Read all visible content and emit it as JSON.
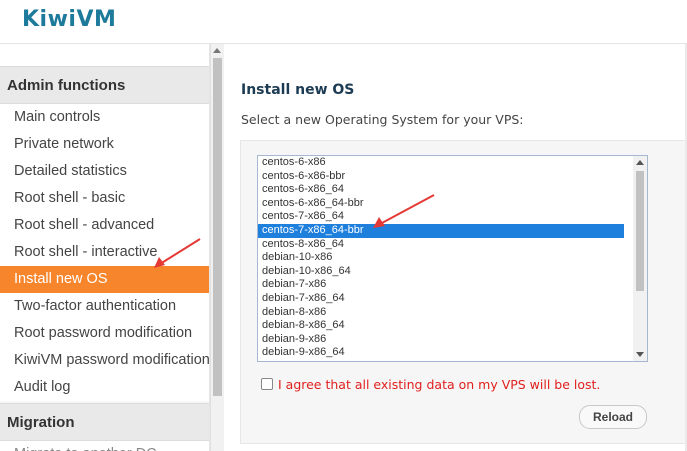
{
  "app": {
    "logo": "KiwiVM"
  },
  "sidebar": {
    "sections": [
      {
        "title": "Admin functions",
        "items": [
          "Main controls",
          "Private network",
          "Detailed statistics",
          "Root shell - basic",
          "Root shell - advanced",
          "Root shell - interactive",
          "Install new OS",
          "Two-factor authentication",
          "Root password modification",
          "KiwiVM password modification",
          "Audit log"
        ],
        "active_index": 6
      },
      {
        "title": "Migration",
        "items": [
          "Migrate to another DC"
        ]
      }
    ]
  },
  "main": {
    "title": "Install new OS",
    "subtitle": "Select a new Operating System for your VPS:",
    "os_options": [
      "centos-6-x86",
      "centos-6-x86-bbr",
      "centos-6-x86_64",
      "centos-6-x86_64-bbr",
      "centos-7-x86_64",
      "centos-7-x86_64-bbr",
      "centos-8-x86_64",
      "debian-10-x86",
      "debian-10-x86_64",
      "debian-7-x86",
      "debian-7-x86_64",
      "debian-8-x86",
      "debian-8-x86_64",
      "debian-9-x86",
      "debian-9-x86_64"
    ],
    "selected_os": "centos-7-x86_64-bbr",
    "agree_label": "I agree that all existing data on my VPS will be lost.",
    "reload_label": "Reload"
  },
  "colors": {
    "active_nav": "#f7852c",
    "selected_option": "#1e7fdc",
    "warning_text": "#e0201e",
    "logo": "#1e7a9b",
    "annotation_arrow": "#e53935"
  }
}
